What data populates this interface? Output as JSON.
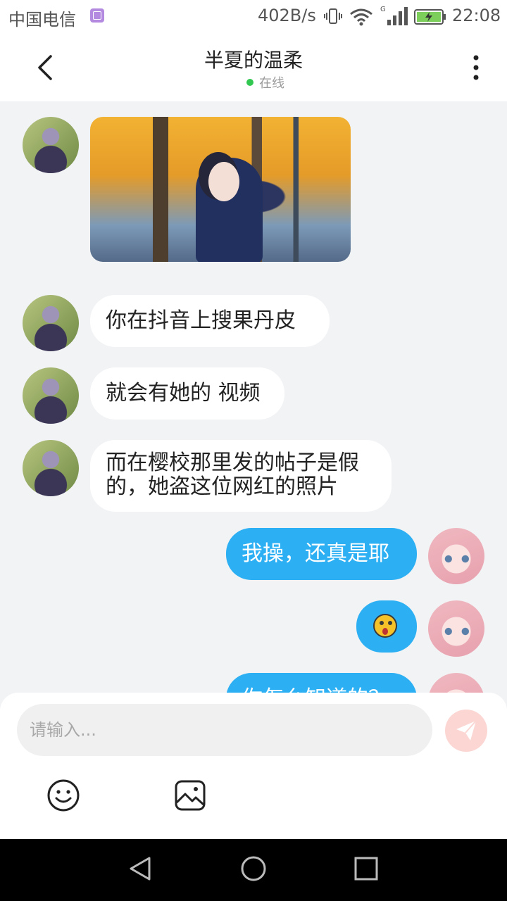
{
  "status_bar": {
    "carrier": "中国电信",
    "net_speed": "402B/s",
    "time": "22:08",
    "signal_label": "G"
  },
  "header": {
    "title": "半夏的温柔",
    "status": "在线",
    "status_color": "#32c750"
  },
  "messages": [
    {
      "side": "left",
      "type": "image",
      "description": "photo"
    },
    {
      "side": "left",
      "type": "text",
      "text": "你在抖音上搜果丹皮"
    },
    {
      "side": "left",
      "type": "text",
      "text": "就会有她的 视频"
    },
    {
      "side": "left",
      "type": "text",
      "text": "而在樱校那里发的帖子是假\n的，她盗这位网红的照片"
    },
    {
      "side": "right",
      "type": "text",
      "text": "我操，还真是耶"
    },
    {
      "side": "right",
      "type": "emoji",
      "icon": "shocked-face-emoji"
    },
    {
      "side": "right",
      "type": "text",
      "text": "你怎么知道的？"
    }
  ],
  "composer": {
    "placeholder": "请输入...",
    "send_icon": "send-icon",
    "emoji_icon": "smiley-icon",
    "image_icon": "image-icon"
  },
  "colors": {
    "accent": "#2cb0f3",
    "background": "#f2f3f5",
    "send_button": "#fbd6d3"
  }
}
